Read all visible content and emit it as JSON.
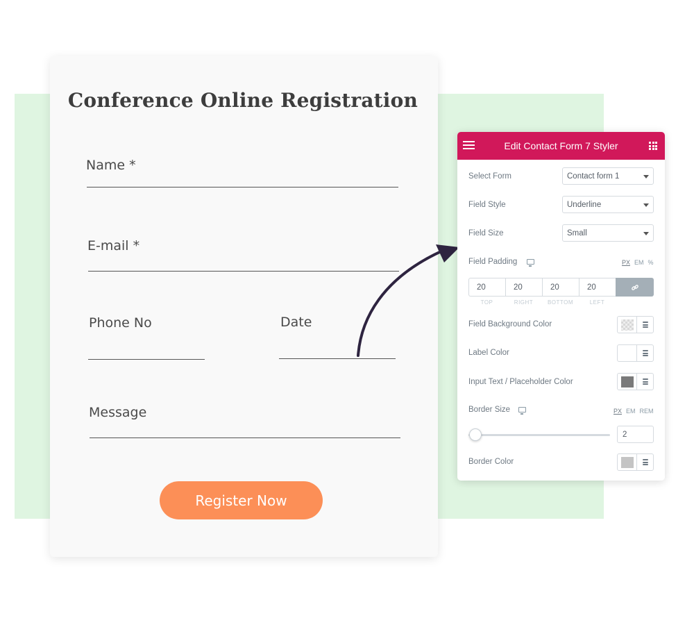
{
  "form": {
    "title": "Conference Online Registration",
    "fields": {
      "name": "Name *",
      "email": "E-mail *",
      "phone": "Phone No",
      "date": "Date",
      "message": "Message"
    },
    "submit_label": "Register Now"
  },
  "panel": {
    "title": "Edit Contact Form 7 Styler",
    "header_icons": [
      "hamburger-menu-icon",
      "apps-grid-icon"
    ],
    "select_form": {
      "label": "Select Form",
      "value": "Contact form 1"
    },
    "field_style": {
      "label": "Field Style",
      "value": "Underline"
    },
    "field_size": {
      "label": "Field Size",
      "value": "Small"
    },
    "field_padding": {
      "label": "Field Padding",
      "units": [
        "PX",
        "EM",
        "%"
      ],
      "active_unit": "PX",
      "values": {
        "top": "20",
        "right": "20",
        "bottom": "20",
        "left": "20"
      },
      "captions": {
        "top": "TOP",
        "right": "RIGHT",
        "bottom": "BOTTOM",
        "left": "LEFT"
      },
      "linked": true
    },
    "field_background_color": {
      "label": "Field Background Color",
      "value": "transparent"
    },
    "label_color": {
      "label": "Label Color",
      "value": "#ffffff"
    },
    "input_text_color": {
      "label": "Input Text / Placeholder Color",
      "value": "#7a7a7a"
    },
    "border_size": {
      "label": "Border Size",
      "units": [
        "PX",
        "EM",
        "REM"
      ],
      "active_unit": "PX",
      "value": "2"
    },
    "border_color": {
      "label": "Border Color",
      "value": "#c4c4c4"
    }
  },
  "colors": {
    "accent": "#d1185a",
    "button": "#fc8f57",
    "background_green": "#dff5e1",
    "arrow": "#2e2440"
  }
}
